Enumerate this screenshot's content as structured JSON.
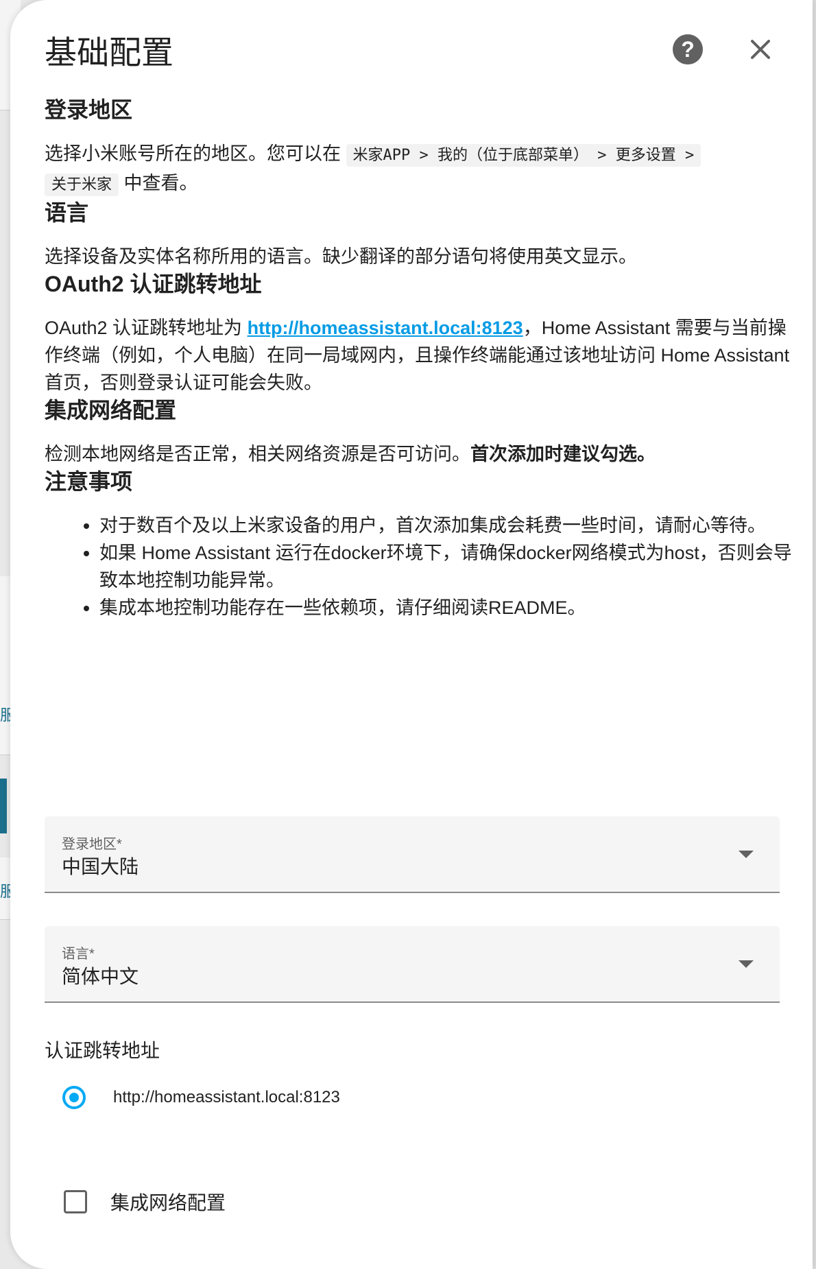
{
  "dialog": {
    "title": "基础配置",
    "help_icon": "help-circle-icon",
    "close_icon": "close-icon"
  },
  "sections": {
    "region": {
      "heading": "登录地区",
      "text_before": "选择小米账号所在的地区。您可以在 ",
      "path_code": "米家APP > 我的（位于底部菜单） > 更多设置 >",
      "path_code_2": "关于米家",
      "text_after": " 中查看。"
    },
    "language": {
      "heading": "语言",
      "text": "选择设备及实体名称所用的语言。缺少翻译的部分语句将使用英文显示。"
    },
    "oauth": {
      "heading": "OAuth2 认证跳转地址",
      "text_before": "OAuth2 认证跳转地址为 ",
      "link": "http://homeassistant.local:8123",
      "text_after": "，Home Assistant 需要与当前操作终端（例如，个人电脑）在同一局域网内，且操作终端能通过该地址访问 Home Assistant 首页，否则登录认证可能会失败。"
    },
    "network": {
      "heading": "集成网络配置",
      "text": "检测本地网络是否正常，相关网络资源是否可访问。",
      "bold": "首次添加时建议勾选。"
    },
    "notes": {
      "heading": "注意事项",
      "items": [
        "对于数百个及以上米家设备的用户，首次添加集成会耗费一些时间，请耐心等待。",
        "如果 Home Assistant 运行在docker环境下，请确保docker网络模式为host，否则会导致本地控制功能异常。",
        "集成本地控制功能存在一些依赖项，请仔细阅读README。"
      ]
    }
  },
  "form": {
    "region_select": {
      "label": "登录地区*",
      "value": "中国大陆"
    },
    "language_select": {
      "label": "语言*",
      "value": "简体中文"
    },
    "redirect": {
      "label": "认证跳转地址",
      "option": "http://homeassistant.local:8123",
      "selected": true
    },
    "network_checkbox": {
      "label": "集成网络配置",
      "checked": false
    }
  },
  "colors": {
    "accent": "#03a9f4",
    "link": "#039be5"
  },
  "background": {
    "char_1": "服",
    "char_2": "服"
  }
}
